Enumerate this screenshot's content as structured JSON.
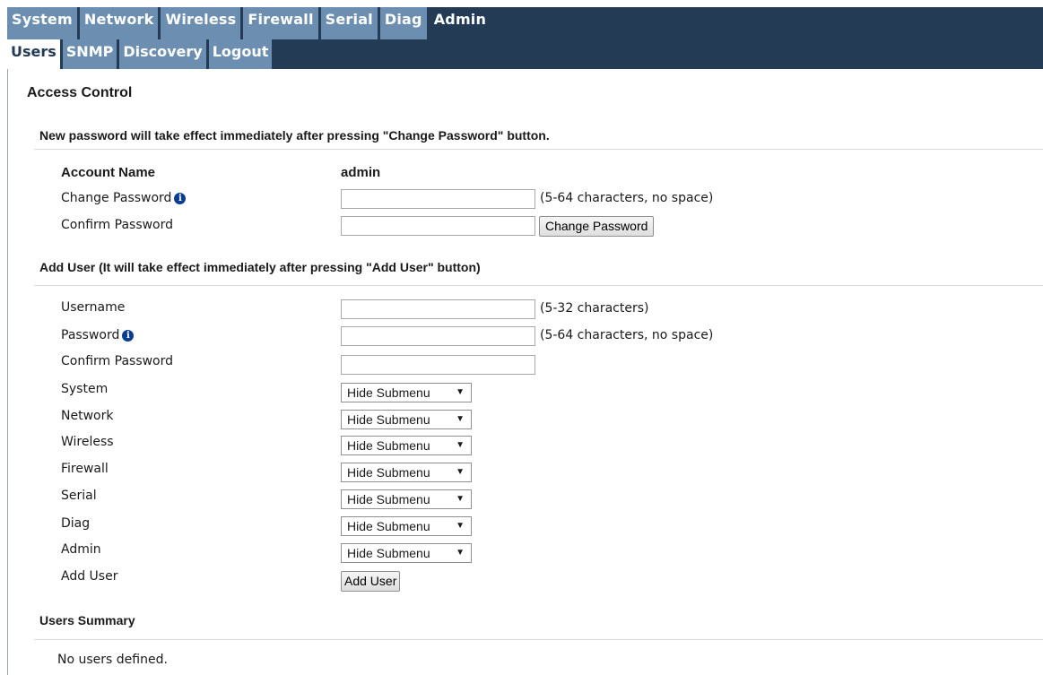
{
  "nav": {
    "main_tabs": [
      {
        "label": "System"
      },
      {
        "label": "Network"
      },
      {
        "label": "Wireless"
      },
      {
        "label": "Firewall"
      },
      {
        "label": "Serial"
      },
      {
        "label": "Diag"
      },
      {
        "label": "Admin",
        "active": true
      }
    ],
    "sub_tabs": [
      {
        "label": "Users",
        "active": true
      },
      {
        "label": "SNMP"
      },
      {
        "label": "Discovery"
      },
      {
        "label": "Logout"
      }
    ]
  },
  "page_title": "Access Control",
  "change_password_section": {
    "heading": "New password will take effect immediately after pressing \"Change Password\" button.",
    "account_name_label": "Account Name",
    "account_name_value": "admin",
    "change_password_label": "Change Password",
    "change_password_value": "",
    "change_password_hint": "(5-64 characters, no space)",
    "confirm_password_label": "Confirm Password",
    "confirm_password_value": "",
    "button_label": "Change Password"
  },
  "add_user_section": {
    "heading": "Add User (It will take effect immediately after pressing \"Add User\" button)",
    "username_label": "Username",
    "username_value": "",
    "username_hint": "(5-32 characters)",
    "password_label": "Password",
    "password_value": "",
    "password_hint": "(5-64 characters, no space)",
    "confirm_password_label": "Confirm Password",
    "confirm_password_value": "",
    "permissions": [
      {
        "label": "System",
        "value": "Hide Submenu"
      },
      {
        "label": "Network",
        "value": "Hide Submenu"
      },
      {
        "label": "Wireless",
        "value": "Hide Submenu"
      },
      {
        "label": "Firewall",
        "value": "Hide Submenu"
      },
      {
        "label": "Serial",
        "value": "Hide Submenu"
      },
      {
        "label": "Diag",
        "value": "Hide Submenu"
      },
      {
        "label": "Admin",
        "value": "Hide Submenu"
      }
    ],
    "add_user_label": "Add User",
    "button_label": "Add User"
  },
  "users_summary": {
    "heading": "Users Summary",
    "empty_text": "No users defined."
  },
  "icons": {
    "info": "info-icon",
    "dropdown": "chevron-down-icon"
  },
  "colors": {
    "nav_dark": "#243b55",
    "tab_blue": "#6c8fb1"
  }
}
